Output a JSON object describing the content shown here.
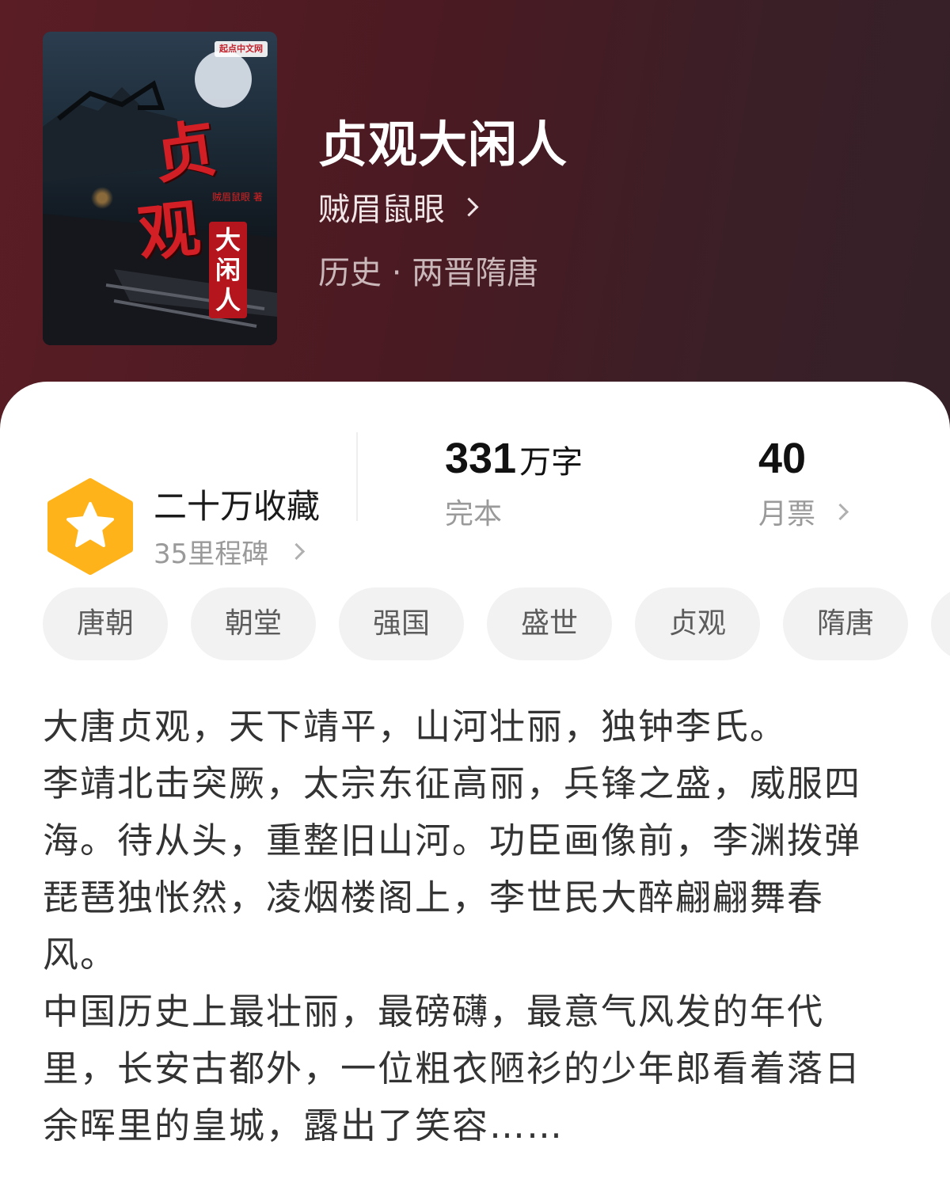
{
  "book": {
    "title": "贞观大闲人",
    "author": "贼眉鼠眼",
    "genre": "历史 · 两晋隋唐"
  },
  "cover": {
    "publisher_logo": "起点中文网",
    "title_char_1": "贞",
    "title_char_2": "观",
    "title_sub": "大闲人",
    "author": "贼眉鼠眼 著"
  },
  "collection": {
    "title": "二十万收藏",
    "subtitle": "35里程碑",
    "icon": "star-badge-icon",
    "badge_color": "#ffb31a"
  },
  "stats": {
    "word_count": "331",
    "word_unit": "万字",
    "status": "完本",
    "monthly_tickets": "40",
    "monthly_label": "月票"
  },
  "tags": [
    "唐朝",
    "朝堂",
    "强国",
    "盛世",
    "贞观",
    "隋唐"
  ],
  "description": [
    "大唐贞观，天下靖平，山河壮丽，独钟李氏。",
    "李靖北击突厥，太宗东征高丽，兵锋之盛，威服四海。待从头，重整旧山河。功臣画像前，李渊拨弹琵琶独怅然，凌烟楼阁上，李世民大醉翩翩舞春风。",
    "中国历史上最壮丽，最磅礴，最意气风发的年代里，长安古都外，一位粗衣陋衫的少年郎看着落日余晖里的皇城，露出了笑容……"
  ],
  "colors": {
    "header_bg": "#4a1a22",
    "cover_title_red": "#d21f26"
  }
}
